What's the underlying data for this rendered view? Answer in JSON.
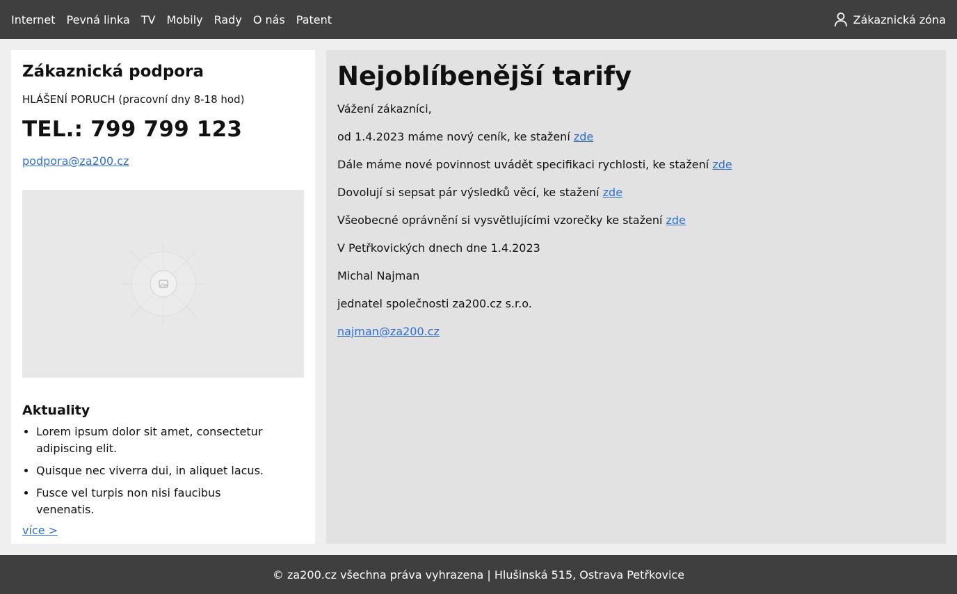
{
  "nav": {
    "items": [
      "Internet",
      "Pevná linka",
      "TV",
      "Mobily",
      "Rady",
      "O nás",
      "Patent"
    ],
    "account_label": "Zákaznická zóna",
    "account_icon": "user-icon"
  },
  "sidebar": {
    "title": "Zákaznická podpora",
    "subtitle": "HLÁŠENÍ PORUCH (pracovní dny 8-18 hod)",
    "phone": "TEL.: 799 799 123",
    "email": "podpora@za200.cz",
    "image_icon": "image-placeholder-icon",
    "news_title": "Aktuality",
    "news": [
      "Lorem ipsum dolor sit amet, consectetur adipiscing elit.",
      "Quisque nec viverra dui, in aliquet lacus.",
      "Fusce vel turpis non nisi faucibus venenatis."
    ],
    "more": "více >"
  },
  "main": {
    "title": "Nejoblíbenější tarify",
    "greeting": "Vážení zákazníci,",
    "lines": [
      {
        "text": "od 1.4.2023 máme nový ceník, ke stažení ",
        "link": "zde"
      },
      {
        "text": "Dále máme nové povinnost uvádět specifikaci rychlosti, ke stažení ",
        "link": "zde"
      },
      {
        "text": "Dovolují si sepsat pár výsledků věcí, ke stažení ",
        "link": "zde"
      },
      {
        "text": "Všeobecné oprávnění si vysvětlujícími vzorečky ke stažení ",
        "link": "zde"
      }
    ],
    "date_line": "V Petřkovických dnech dne 1.4.2023",
    "signature_name": "Michal Najman",
    "signature_role": "jednatel společnosti za200.cz s.r.o.",
    "signature_email": "najman@za200.cz"
  },
  "footer": {
    "text": "© za200.cz všechna práva vyhrazena | Hlušinská 515, Ostrava Petřkovice"
  },
  "colors": {
    "topbar": "#3f3f3f",
    "link": "#2f6fd1",
    "main_bg": "#e2e2e2",
    "page_bg": "#efefef"
  }
}
